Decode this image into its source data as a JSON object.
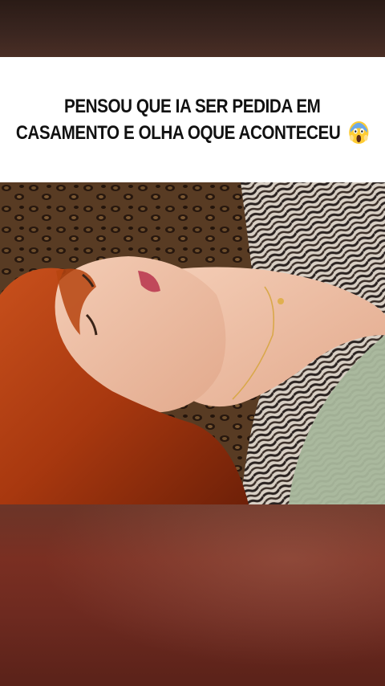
{
  "caption": {
    "line1": "PENSOU QUE IA SER PEDIDA EM",
    "line2": "CASAMENTO E OLHA OQUE ACONTECEU",
    "emoji": "face-screaming-in-fear-emoji"
  },
  "video": {
    "scene": "video-frame-image"
  },
  "colors": {
    "caption_background": "#ffffff",
    "caption_text": "#111111"
  }
}
